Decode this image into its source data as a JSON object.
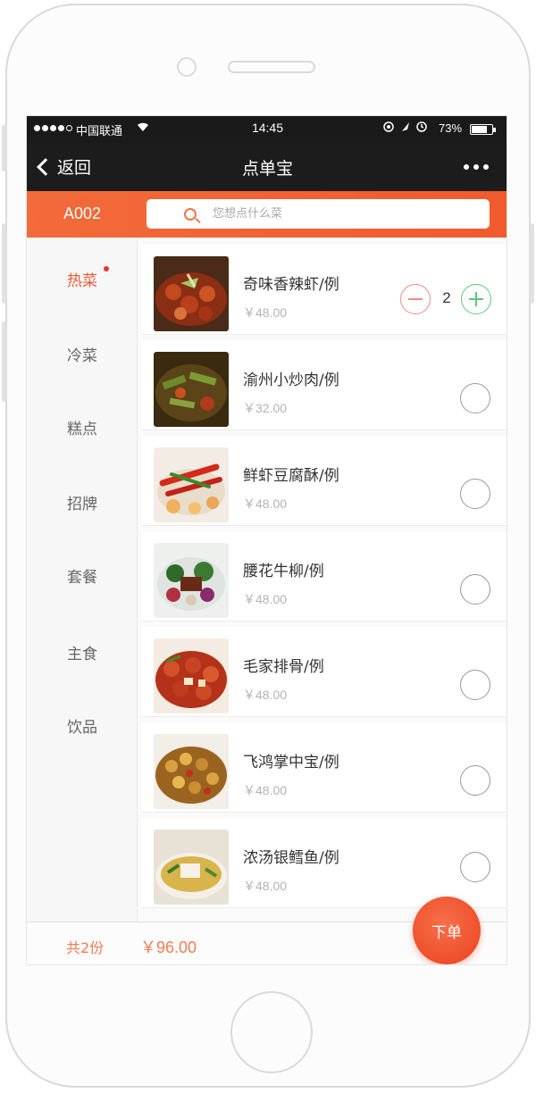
{
  "status_bar": {
    "carrier": "中国联通",
    "time": "14:45",
    "battery": "73%",
    "signal_icon": "signal-dots-icon",
    "wifi_icon": "wifi-icon"
  },
  "navbar": {
    "back_label": "返回",
    "title": "点单宝",
    "more_icon": "more-dots-icon"
  },
  "header": {
    "table_id": "A002",
    "search_placeholder": "您想点什么菜"
  },
  "sidebar": {
    "categories": [
      {
        "label": "热菜",
        "active": true,
        "has_dot": true
      },
      {
        "label": "冷菜",
        "active": false
      },
      {
        "label": "糕点",
        "active": false
      },
      {
        "label": "招牌",
        "active": false
      },
      {
        "label": "套餐",
        "active": false
      },
      {
        "label": "主食",
        "active": false
      },
      {
        "label": "饮品",
        "active": false
      }
    ]
  },
  "dishes": [
    {
      "name": "奇味香辣虾/例",
      "price": "￥48.00",
      "quantity": "2"
    },
    {
      "name": "渝州小炒肉/例",
      "price": "￥32.00"
    },
    {
      "name": "鲜虾豆腐酥/例",
      "price": "￥48.00"
    },
    {
      "name": "腰花牛柳/例",
      "price": "￥48.00"
    },
    {
      "name": "毛家排骨/例",
      "price": "￥48.00"
    },
    {
      "name": "飞鸿掌中宝/例",
      "price": "￥48.00"
    },
    {
      "name": "浓汤银鳕鱼/例",
      "price": "￥48.00"
    }
  ],
  "footer": {
    "total_count": "共2份",
    "total_price": "￥96.00",
    "order_button": "下单"
  },
  "colors": {
    "accent": "#f05a2c",
    "nav_bg": "#1c1c1c",
    "plus_green": "#5cc77a",
    "minus_red": "#f08a84"
  }
}
